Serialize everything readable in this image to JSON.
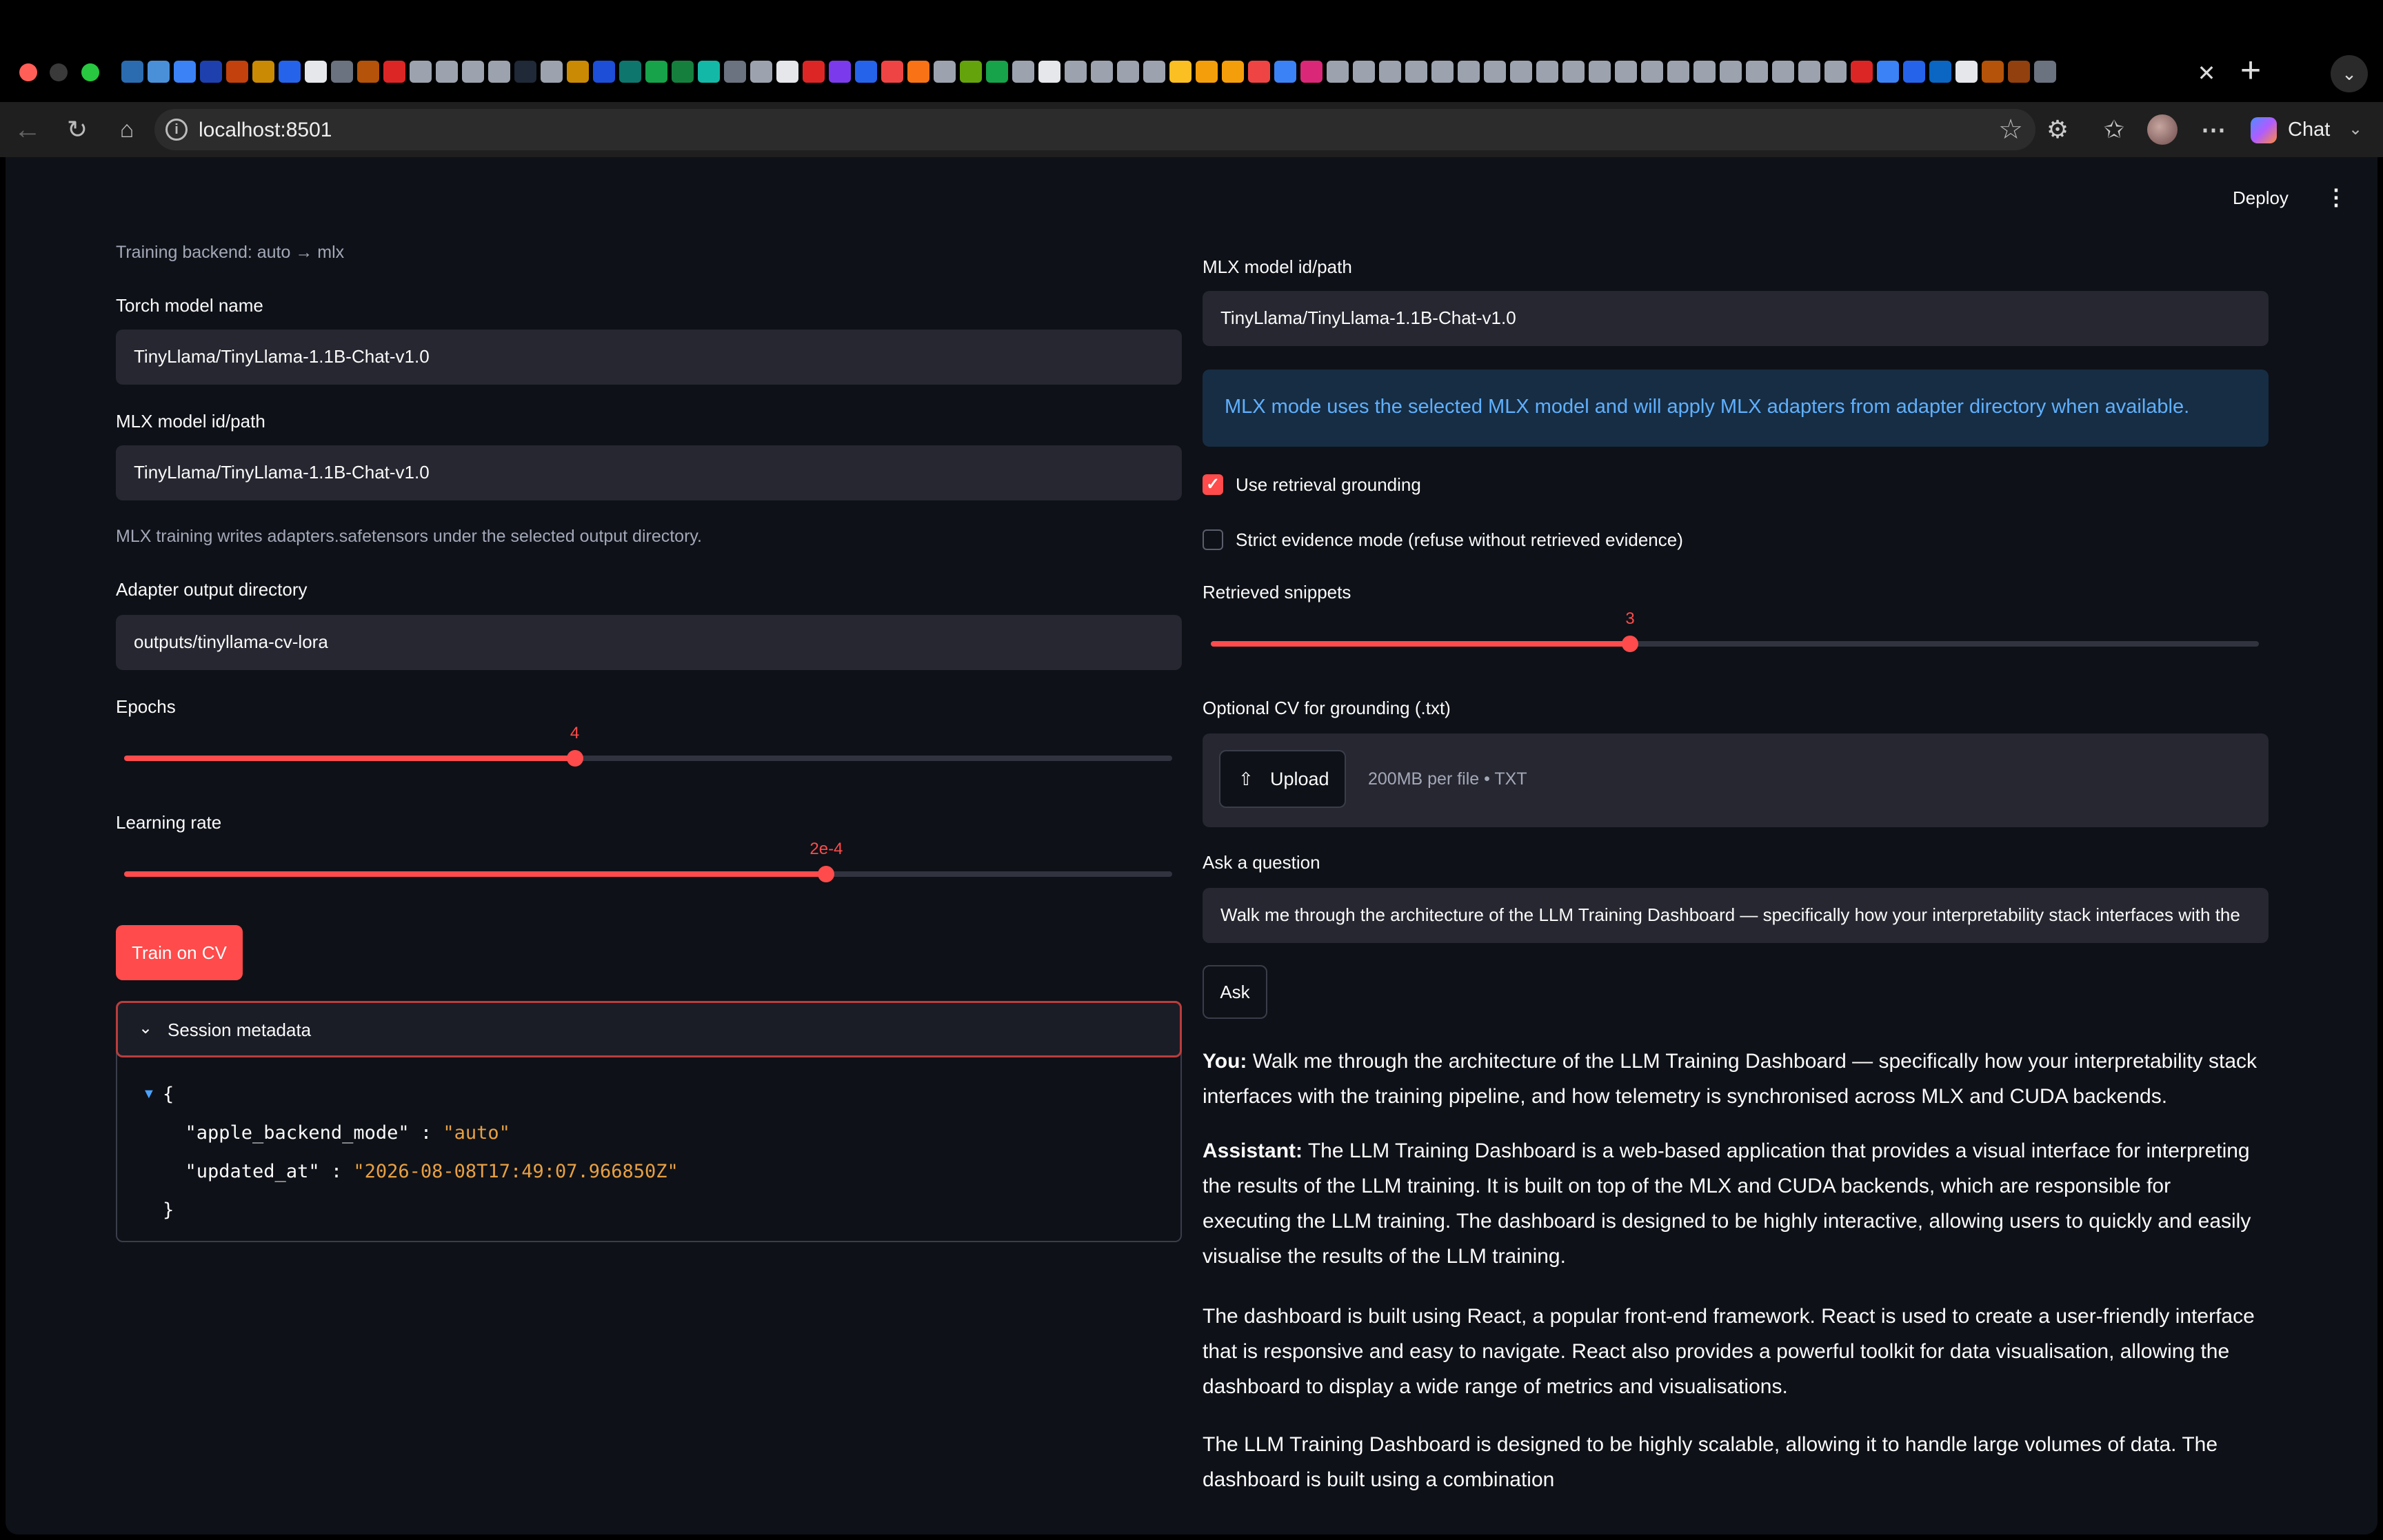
{
  "browser": {
    "url": "localhost:8501",
    "chat_label": "Chat",
    "tab_favicon_colors": [
      "#2b6cb0",
      "#4a90d9",
      "#3b82f6",
      "#1e40af",
      "#c2410c",
      "#ca8a04",
      "#2563eb",
      "#e5e7eb",
      "#6b7280",
      "#b45309",
      "#dc2626",
      "#9ca3af",
      "#9ca3af",
      "#9ca3af",
      "#9ca3af",
      "#1f2937",
      "#9ca3af",
      "#ca8a04",
      "#1d4ed8",
      "#0f766e",
      "#16a34a",
      "#15803d",
      "#14b8a6",
      "#6b7280",
      "#9ca3af",
      "#e5e7eb",
      "#dc2626",
      "#7c3aed",
      "#2563eb",
      "#ef4444",
      "#f97316",
      "#9ca3af",
      "#65a30d",
      "#16a34a",
      "#9ca3af",
      "#e5e7eb",
      "#9ca3af",
      "#9ca3af",
      "#9ca3af",
      "#9ca3af",
      "#fbbf24",
      "#f59e0b",
      "#f59e0b",
      "#ef4444",
      "#3b82f6",
      "#db2777",
      "#9ca3af",
      "#9ca3af",
      "#9ca3af",
      "#9ca3af",
      "#9ca3af",
      "#9ca3af",
      "#9ca3af",
      "#9ca3af",
      "#9ca3af",
      "#9ca3af",
      "#9ca3af",
      "#9ca3af",
      "#9ca3af",
      "#9ca3af",
      "#9ca3af",
      "#9ca3af",
      "#9ca3af",
      "#9ca3af",
      "#9ca3af",
      "#9ca3af",
      "#dc2626",
      "#3b82f6",
      "#2563eb",
      "#0a66c2",
      "#e5e7eb",
      "#b45309",
      "#92400e",
      "#6b7280"
    ]
  },
  "header": {
    "deploy_label": "Deploy"
  },
  "left": {
    "backend_caption": "Training backend: auto → mlx",
    "torch_label": "Torch model name",
    "torch_value": "TinyLlama/TinyLlama-1.1B-Chat-v1.0",
    "mlx_label": "MLX model id/path",
    "mlx_value": "TinyLlama/TinyLlama-1.1B-Chat-v1.0",
    "mlx_caption": "MLX training writes adapters.safetensors under the selected output directory.",
    "adapter_label": "Adapter output directory",
    "adapter_value": "outputs/tinyllama-cv-lora",
    "epochs_label": "Epochs",
    "epochs_value": "4",
    "epochs_fraction": 0.43,
    "lr_label": "Learning rate",
    "lr_value": "2e-4",
    "lr_fraction": 0.67,
    "train_button": "Train on CV",
    "expander_title": "Session metadata",
    "metadata": {
      "open": "{",
      "k1": "\"apple_backend_mode\"",
      "v1": "\"auto\"",
      "k2": "\"updated_at\"",
      "v2": "\"2026-08-08T17:49:07.966850Z\"",
      "sep": " : ",
      "close": "}"
    }
  },
  "right": {
    "mlx_label": "MLX model id/path",
    "mlx_value": "TinyLlama/TinyLlama-1.1B-Chat-v1.0",
    "info": "MLX mode uses the selected MLX model and will apply MLX adapters from adapter directory when available.",
    "retrieval_label": "Use retrieval grounding",
    "retrieval_checked": true,
    "strict_label": "Strict evidence mode (refuse without retrieved evidence)",
    "strict_checked": false,
    "snippets_label": "Retrieved snippets",
    "snippets_value": "3",
    "snippets_fraction": 0.4,
    "cv_label": "Optional CV for grounding (.txt)",
    "upload_button": "Upload",
    "upload_hint": "200MB per file • TXT",
    "question_label": "Ask a question",
    "question_value": "Walk me through the architecture of the LLM Training Dashboard — specifically how your interpretability stack interfaces with the",
    "ask_button": "Ask",
    "you_prefix": "You:",
    "you_text": "Walk me through the architecture of the LLM Training Dashboard — specifically how your interpretability stack interfaces with the training pipeline, and how telemetry is synchronised across MLX and CUDA backends.",
    "assistant_prefix": "Assistant:",
    "assistant_p1": "The LLM Training Dashboard is a web-based application that provides a visual interface for interpreting the results of the LLM training. It is built on top of the MLX and CUDA backends, which are responsible for executing the LLM training. The dashboard is designed to be highly interactive, allowing users to quickly and easily visualise the results of the LLM training.",
    "assistant_p2": "The dashboard is built using React, a popular front-end framework. React is used to create a user-friendly interface that is responsive and easy to navigate. React also provides a powerful toolkit for data visualisation, allowing the dashboard to display a wide range of metrics and visualisations.",
    "assistant_p3": "The LLM Training Dashboard is designed to be highly scalable, allowing it to handle large volumes of data. The dashboard is built using a combination"
  },
  "colors": {
    "accent": "#ff4b4b",
    "background": "#0e1117",
    "input_bg": "#262730",
    "info_bg": "#172d43",
    "info_text": "#5fb0ff",
    "json_string": "#e8a044"
  }
}
